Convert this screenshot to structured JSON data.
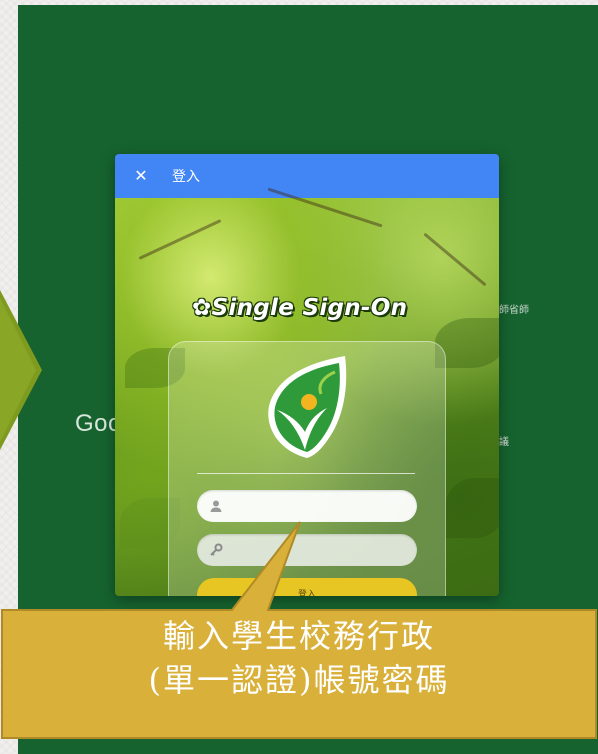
{
  "dialog": {
    "close_glyph": "✕",
    "title": "登入"
  },
  "background": {
    "google_text": "Goo",
    "right_text_1": "師省師",
    "right_text_2": "議"
  },
  "sso": {
    "title": "✿Single Sign-On",
    "username_placeholder": "",
    "password_placeholder": "",
    "login_label": "登入"
  },
  "callout": {
    "line1": "輸入學生校務行政",
    "line2": "(單一認證)帳號密碼"
  },
  "colors": {
    "screen_bg": "#16632f",
    "header_bar": "#4285f4",
    "login_button": "#e7c522",
    "callout_fill": "#d9b03a",
    "arrow": "#7e9a1f"
  },
  "icons": [
    "close-icon",
    "user-icon",
    "key-icon",
    "sso-logo-icon",
    "flower-icon"
  ]
}
